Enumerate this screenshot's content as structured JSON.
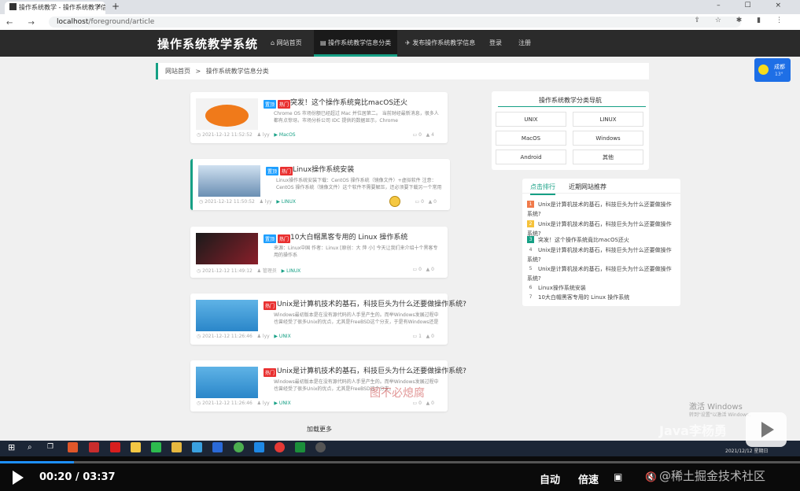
{
  "browser": {
    "tab_title": "操作系统教学 - 操作系统教学信息",
    "tab_close": "×",
    "new_tab": "+",
    "window_controls": "– ☐ ×",
    "nav_icons": "← → ⟳ ⓘ",
    "url_host": "localhost",
    "url_path": "/foreground/article",
    "right_icons": "⇪ ☆ ✱ ▮ ⋮"
  },
  "site": {
    "title": "操作系统教学系统",
    "nav": [
      {
        "label": "⌂ 网站首页"
      },
      {
        "label": "▤ 操作系统教学信息分类"
      },
      {
        "label": "✈ 发布操作系统教学信息"
      },
      {
        "label": "登录"
      },
      {
        "label": "注册"
      }
    ]
  },
  "breadcrumb": {
    "home": "网站首页",
    "sep": ">",
    "current": "操作系统教学信息分类"
  },
  "articles": [
    {
      "badge_top": "置顶",
      "badge_hot": "热门",
      "title": "突发！这个操作系统竟比macOS还火",
      "desc": "Chrome OS 市场份额已经超过 Mac 并位居第二。 当前财经最新消息，很多人都有点惊讶。市场分析公司 IDC 提供的数据显示，Chrome",
      "date": "◷ 2021-12-12 11:52:52",
      "author": "♟ lyy",
      "category": "▶ MacOS",
      "comments": "▭ 0",
      "likes": "▲ 4",
      "thumb": "#f07a1a"
    },
    {
      "badge_top": "置顶",
      "badge_hot": "热门",
      "title": "Linux操作系统安装",
      "desc": "Linux操作系统安装下载：CentOS 操作系统（镜像文件）+虚拟软件 注意：CentOS 操作系统（镜像文件）这个软件不需要解压，还必须要下载另一个常用的文件来做",
      "date": "◷ 2021-12-12 11:50:52",
      "author": "♟ lyy",
      "category": "▶ LINUX",
      "comments": "▭ 0",
      "likes": "▲ 0",
      "thumb": "#6a8fb3"
    },
    {
      "badge_top": "置顶",
      "badge_hot": "热门",
      "title": "10大白帽黑客专用的 Linux 操作系统",
      "desc": "来源：Linux中国 作者：Linux [原创：大 萍 小] 今天让我们来介绍十个黑客专用的操作系",
      "date": "◷ 2021-12-12 11:49:12",
      "author": "♟ 管理员",
      "category": "▶ LINUX",
      "comments": "▭ 0",
      "likes": "▲ 0",
      "thumb": "#8a1f2a"
    },
    {
      "badge_top": "",
      "badge_hot": "热门",
      "title": "Unix是计算机技术的基石，科技巨头为什么还要做操作系统?",
      "desc": "Windows最初版本是在没有源代码的人手里产生的。而举Windows发展过程中也曾经受了很多Unix的优点，尤其是FreeBSD这个分支，于是有Windows还是MacOS都",
      "date": "◷ 2021-12-12 11:26:46",
      "author": "♟ lyy",
      "category": "▶ UNIX",
      "comments": "▭ 1",
      "likes": "▲ 0",
      "thumb": "#2a86c9"
    },
    {
      "badge_top": "",
      "badge_hot": "热门",
      "title": "Unix是计算机技术的基石，科技巨头为什么还要做操作系统?",
      "desc": "Windows最初版本是在没有源代码的人手里产生的。而举Windows发展过程中也曾经受了很多Unix的优点，尤其是FreeBSD这个分支。",
      "date": "◷ 2021-12-12 11:26:46",
      "author": "♟ lyy",
      "category": "▶ UNIX",
      "comments": "▭ 0",
      "likes": "▲ 0",
      "thumb": "#2a86c9"
    }
  ],
  "load_more": "加载更多",
  "category_panel": {
    "title": "操作系统教学分类导航",
    "buttons": [
      "UNIX",
      "LINUX",
      "MacOS",
      "Windows",
      "Android",
      "其他"
    ]
  },
  "rank_panel": {
    "tabs": [
      "点击排行",
      "近期网站推荐"
    ],
    "items": [
      {
        "num": "1",
        "text": "Unix是计算机技术的基石，科技巨头为什么还要做操作系统?",
        "color": "#f07a4a"
      },
      {
        "num": "2",
        "text": "Unix是计算机技术的基石，科技巨头为什么还要做操作系统?",
        "color": "#f5c23a"
      },
      {
        "num": "3",
        "text": "突发！这个操作系统竟比macOS还火",
        "color": "#16a085"
      },
      {
        "num": "4",
        "text": "Unix是计算机技术的基石，科技巨头为什么还要做操作系统?",
        "color": ""
      },
      {
        "num": "5",
        "text": "Unix是计算机技术的基石，科技巨头为什么还要做操作系统?",
        "color": ""
      },
      {
        "num": "6",
        "text": "Linux操作系统安装",
        "color": ""
      },
      {
        "num": "7",
        "text": "10大白帽黑客专用的 Linux 操作系统",
        "color": ""
      }
    ]
  },
  "weather": {
    "city": "成都",
    "temp": "13°"
  },
  "overlay": {
    "activate": "激活 Windows",
    "activate_sub": "转到\"设置\"以激活 Windows。",
    "watermark_top": "Java李杨勇",
    "watermark_bottom": "@稀土掘金技术社区",
    "mid_watermark": "图不必熄腐"
  },
  "taskbar": {
    "time": "2021/12/12 星期日"
  },
  "player": {
    "current": "00:20",
    "sep": "/",
    "duration": "03:37",
    "progress": 0.092,
    "auto": "自动",
    "speed": "倍速"
  }
}
